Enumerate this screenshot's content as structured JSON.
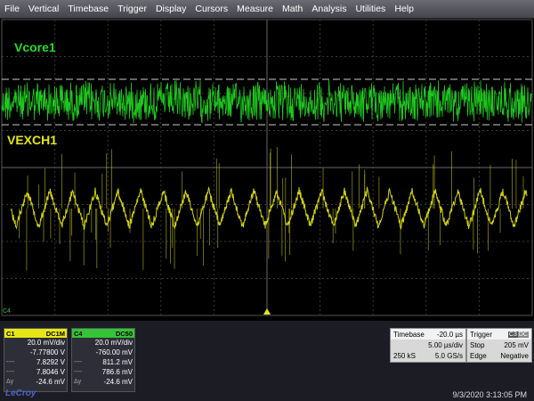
{
  "menu": [
    "File",
    "Vertical",
    "Timebase",
    "Trigger",
    "Display",
    "Cursors",
    "Measure",
    "Math",
    "Analysis",
    "Utilities",
    "Help"
  ],
  "traces": {
    "ch1_label": "Vcore1",
    "ch1_color": "#22dd22",
    "ch2_label": "VEXCH1",
    "ch2_color": "#dddd11"
  },
  "markers": {
    "ch4_marker": "C4"
  },
  "c1": {
    "tag": "C1",
    "coupling": "DC1M",
    "vdiv": "20.0 mV/div",
    "offset": "-7.77800 V",
    "cursor1": "7.8292 V",
    "cursor2": "7.8046 V",
    "delta_label": "Δy",
    "delta": "-24.6 mV",
    "color": "#e6e617"
  },
  "c4": {
    "tag": "C4",
    "coupling": "DC50",
    "vdiv": "20.0 mV/div",
    "offset": "-760.00 mV",
    "cursor1": "811.2 mV",
    "cursor2": "786.6 mV",
    "delta_label": "Δy",
    "delta": "-24.6 mV",
    "color": "#35c435"
  },
  "timebase": {
    "label": "Timebase",
    "delay": "-20.0 µs",
    "per_div": "5.00 µs/div",
    "samples": "250 kS",
    "rate": "5.0 GS/s"
  },
  "trigger": {
    "label": "Trigger",
    "channel": "C3",
    "coupling": "DC",
    "mode": "Stop",
    "level": "205 mV",
    "type": "Edge",
    "slope": "Negative"
  },
  "brand": "LeCroy",
  "datetime": "9/3/2020 3:13:05 PM"
}
